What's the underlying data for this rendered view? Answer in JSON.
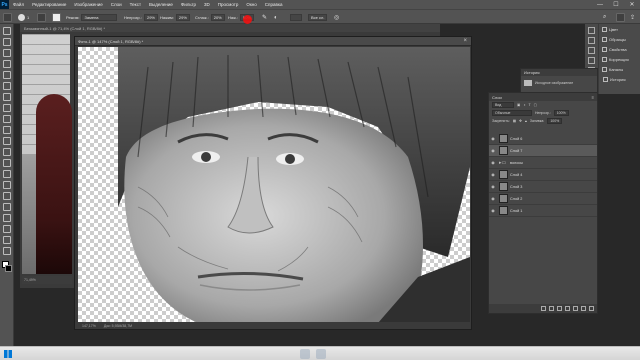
{
  "app": {
    "logo": "Ps"
  },
  "menubar": {
    "items": [
      "Файл",
      "Редактирование",
      "Изображение",
      "Слои",
      "Текст",
      "Выделение",
      "Фильтр",
      "3D",
      "Просмотр",
      "Окно",
      "Справка"
    ],
    "controls": {
      "minimize": "—",
      "maximize": "☐",
      "close": "✕"
    }
  },
  "optionsbar": {
    "brush_size": "1",
    "mode_label": "Режим:",
    "mode_value": "Замена",
    "opacity_label": "Непрозр.:",
    "opacity_value": "29%",
    "pressure_label": "Нажим:",
    "pressure_value": "29%",
    "smoothing_label": "Сглаж.:",
    "smoothing_value": "20%",
    "flow_label": "Наж.:",
    "flow_value": "50%",
    "sample_label": "Все сл."
  },
  "background_doc": {
    "tab": "Безымянный-1 @ 71,4% (Слой 1, RGB/8#) *",
    "zoom": "71,49%"
  },
  "document": {
    "title": "Фото-1 @ 147% (Слой 1, RGB/8#) *",
    "zoom": "147,17%",
    "size": "Док: 5,93M/38,7M"
  },
  "right_dock": {
    "panels": [
      {
        "icon": "swatches-icon",
        "label": "Цвет"
      },
      {
        "icon": "pattern-icon",
        "label": "Образцы"
      },
      {
        "icon": "library-icon",
        "label": "Свойства"
      },
      {
        "icon": "adjust-icon",
        "label": "Коррекция"
      },
      {
        "icon": "channels-icon",
        "label": "Каналы"
      }
    ]
  },
  "history": {
    "title": "История",
    "items": [
      "Исходное изображение"
    ],
    "dock_label": "История"
  },
  "layers": {
    "title": "Слои",
    "filter_label": "Вид",
    "blend_mode": "Обычные",
    "opacity_label": "Непрозр.:",
    "opacity_value": "100%",
    "lock_label": "Закрепить:",
    "fill_label": "Заливка:",
    "fill_value": "100%",
    "items": [
      {
        "name": "Слой 6",
        "selected": false,
        "visible": true,
        "group": false
      },
      {
        "name": "Слой 7",
        "selected": true,
        "visible": true,
        "group": false
      },
      {
        "name": "волосы",
        "selected": false,
        "visible": true,
        "group": true
      },
      {
        "name": "Слой 4",
        "selected": false,
        "visible": true,
        "group": false
      },
      {
        "name": "Слой 3",
        "selected": false,
        "visible": true,
        "group": false
      },
      {
        "name": "Слой 2",
        "selected": false,
        "visible": true,
        "group": false
      },
      {
        "name": "Слой 1",
        "selected": false,
        "visible": true,
        "group": false
      }
    ]
  }
}
